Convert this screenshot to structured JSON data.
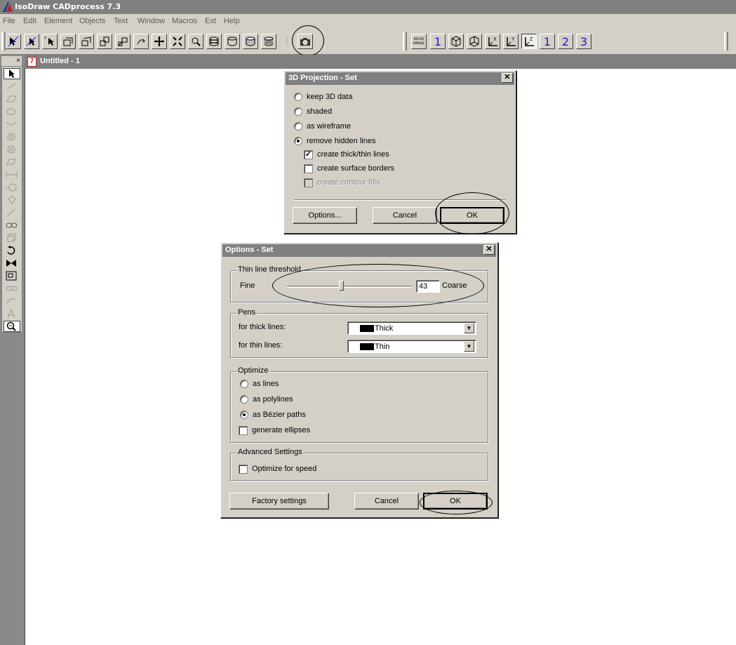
{
  "app": {
    "title": "IsoDraw CADprocess 7.3"
  },
  "menu": [
    "File",
    "Edit",
    "Element",
    "Objects",
    "Text",
    "Window",
    "Macros",
    "Ext",
    "Help"
  ],
  "toolbar": {
    "move_image_label": "MOVE IMAGE",
    "view_buttons": [
      "1",
      "2",
      "3"
    ],
    "axis_labels": [
      "X",
      "Y",
      "Z"
    ],
    "camera_icon": "camera-icon"
  },
  "document": {
    "title": "Untitled - 1"
  },
  "projection_dialog": {
    "title": "3D Projection - Set",
    "radios": [
      {
        "label": "keep 3D data",
        "checked": false
      },
      {
        "label": "shaded",
        "checked": false
      },
      {
        "label": "as wireframe",
        "checked": false
      },
      {
        "label": "remove hidden lines",
        "checked": true
      }
    ],
    "checkboxes": [
      {
        "label": "create thick/thin lines",
        "checked": true,
        "enabled": true
      },
      {
        "label": "create surface borders",
        "checked": false,
        "enabled": true
      },
      {
        "label": "create contour fills",
        "checked": false,
        "enabled": false
      }
    ],
    "buttons": {
      "options": "Options...",
      "cancel": "Cancel",
      "ok": "OK"
    }
  },
  "options_dialog": {
    "title": "Options - Set",
    "threshold": {
      "group_label": "Thin line threshold",
      "min_label": "Fine",
      "max_label": "Coarse",
      "value": "43",
      "position_fraction": 0.43
    },
    "pens": {
      "group_label": "Pens",
      "thick_label": "for thick lines:",
      "thick_value": "Thick",
      "thin_label": "for thin lines:",
      "thin_value": "Thin"
    },
    "optimize": {
      "group_label": "Optimize",
      "radios": [
        {
          "label": "as lines",
          "checked": false
        },
        {
          "label": "as polylines",
          "checked": false
        },
        {
          "label": "as Bézier paths",
          "checked": true
        }
      ],
      "ellipses_label": "generate ellipses",
      "ellipses_checked": false
    },
    "advanced": {
      "group_label": "Advanced Settings",
      "speed_label": "Optimize for speed",
      "speed_checked": false
    },
    "buttons": {
      "factory": "Factory settings",
      "cancel": "Cancel",
      "ok": "OK"
    }
  },
  "colors": {
    "dialog_bg": "#d4d0c8",
    "title_bar": "#808080",
    "accent_blue": "#1d1dcc"
  }
}
